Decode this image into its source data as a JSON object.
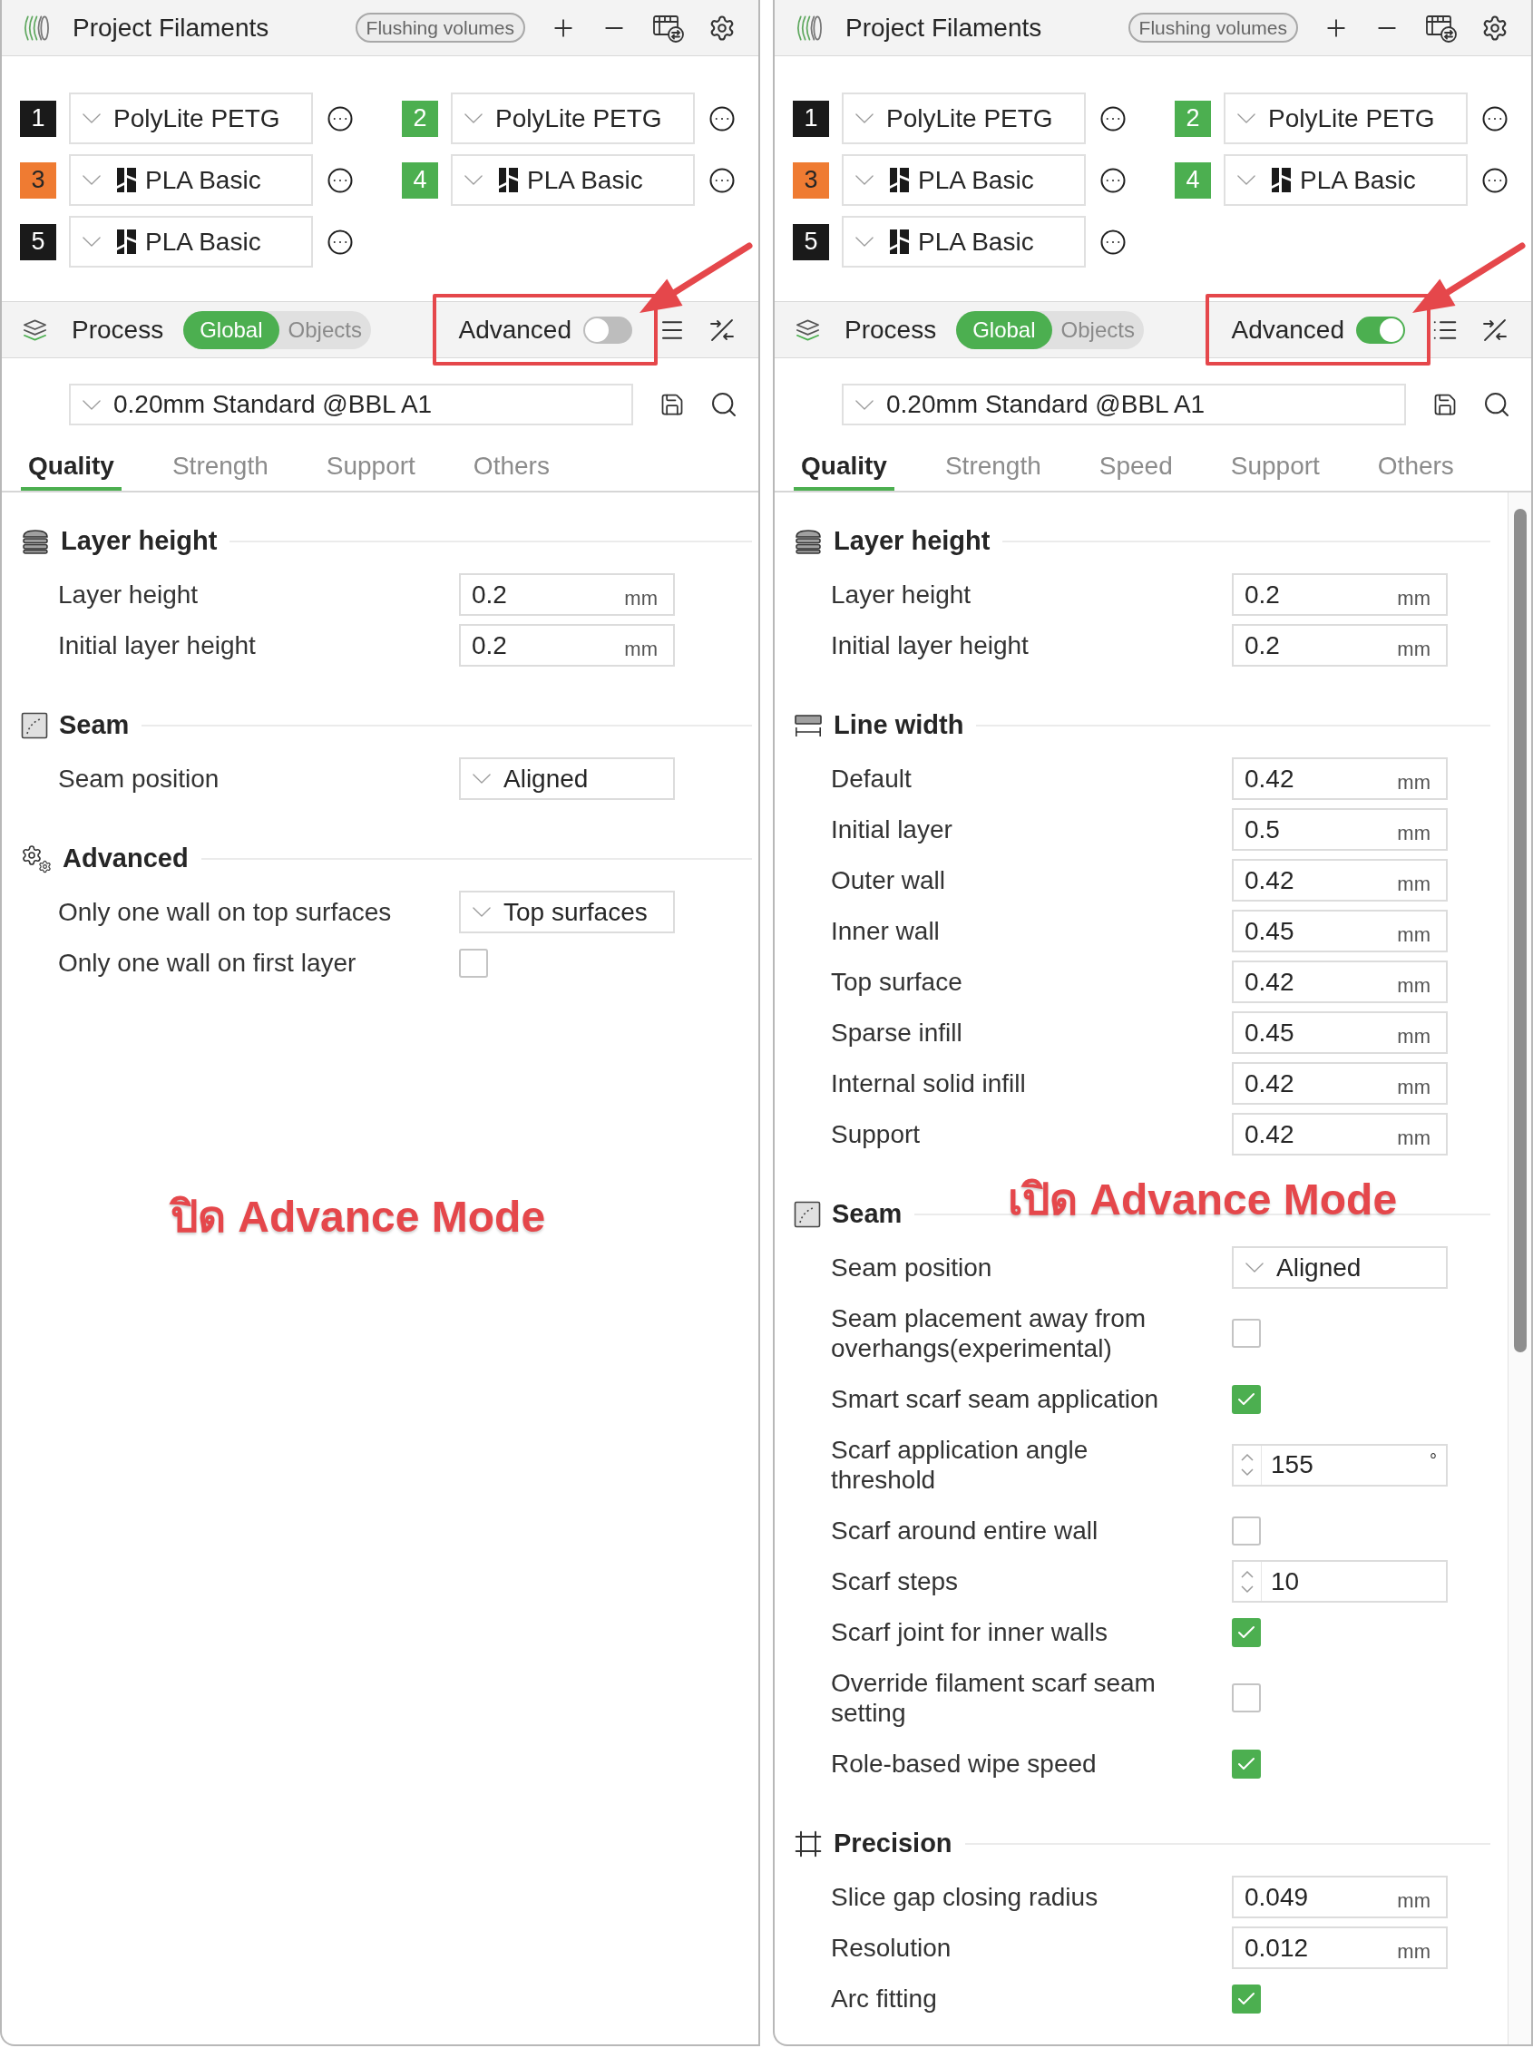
{
  "panels": [
    {
      "header": {
        "title": "Project Filaments",
        "flushing_button": "Flushing volumes"
      },
      "filaments": [
        {
          "number": "1",
          "color": "#1a1a1a",
          "name": "PolyLite PETG",
          "logo": false
        },
        {
          "number": "2",
          "color": "#4caf50",
          "name": "PolyLite PETG",
          "logo": false
        },
        {
          "number": "3",
          "color": "#ef7b32",
          "name": "PLA Basic",
          "logo": true
        },
        {
          "number": "4",
          "color": "#4caf50",
          "name": "PLA Basic",
          "logo": true
        },
        {
          "number": "5",
          "color": "#1a1a1a",
          "name": "PLA Basic",
          "logo": true
        }
      ],
      "process": {
        "title": "Process",
        "scopes": [
          {
            "label": "Global",
            "selected": true
          },
          {
            "label": "Objects",
            "selected": false
          }
        ],
        "advanced": {
          "label": "Advanced",
          "on": false
        }
      },
      "preset": "0.20mm Standard @BBL A1",
      "tabs": [
        {
          "label": "Quality",
          "selected": true
        },
        {
          "label": "Strength",
          "selected": false
        },
        {
          "label": "Support",
          "selected": false
        },
        {
          "label": "Others",
          "selected": false
        }
      ],
      "sections": [
        {
          "title": "Layer height",
          "kind": "layers",
          "rows": [
            {
              "kind": "number",
              "label": "Layer height",
              "value": "0.2",
              "unit": "mm"
            },
            {
              "kind": "number",
              "label": "Initial layer height",
              "value": "0.2",
              "unit": "mm"
            }
          ]
        },
        {
          "title": "Seam",
          "kind": "seam",
          "rows": [
            {
              "kind": "select",
              "label": "Seam position",
              "value": "Aligned"
            }
          ]
        },
        {
          "title": "Advanced",
          "kind": "advanced",
          "rows": [
            {
              "kind": "select",
              "label": "Only one wall on top surfaces",
              "value": "Top surfaces"
            },
            {
              "kind": "checkbox",
              "label": "Only one wall on first layer",
              "checked": false
            }
          ]
        }
      ],
      "annotation": "ปิด Advance Mode",
      "scrollbar": false
    },
    {
      "header": {
        "title": "Project Filaments",
        "flushing_button": "Flushing volumes"
      },
      "filaments": [
        {
          "number": "1",
          "color": "#1a1a1a",
          "name": "PolyLite PETG",
          "logo": false
        },
        {
          "number": "2",
          "color": "#4caf50",
          "name": "PolyLite PETG",
          "logo": false
        },
        {
          "number": "3",
          "color": "#ef7b32",
          "name": "PLA Basic",
          "logo": true
        },
        {
          "number": "4",
          "color": "#4caf50",
          "name": "PLA Basic",
          "logo": true
        },
        {
          "number": "5",
          "color": "#1a1a1a",
          "name": "PLA Basic",
          "logo": true
        }
      ],
      "process": {
        "title": "Process",
        "scopes": [
          {
            "label": "Global",
            "selected": true
          },
          {
            "label": "Objects",
            "selected": false
          }
        ],
        "advanced": {
          "label": "Advanced",
          "on": true
        }
      },
      "preset": "0.20mm Standard @BBL A1",
      "tabs": [
        {
          "label": "Quality",
          "selected": true
        },
        {
          "label": "Strength",
          "selected": false
        },
        {
          "label": "Speed",
          "selected": false
        },
        {
          "label": "Support",
          "selected": false
        },
        {
          "label": "Others",
          "selected": false
        }
      ],
      "sections": [
        {
          "title": "Layer height",
          "kind": "layers",
          "rows": [
            {
              "kind": "number",
              "label": "Layer height",
              "value": "0.2",
              "unit": "mm"
            },
            {
              "kind": "number",
              "label": "Initial layer height",
              "value": "0.2",
              "unit": "mm"
            }
          ]
        },
        {
          "title": "Line width",
          "kind": "linewidth",
          "rows": [
            {
              "kind": "number",
              "label": "Default",
              "value": "0.42",
              "unit": "mm"
            },
            {
              "kind": "number",
              "label": "Initial layer",
              "value": "0.5",
              "unit": "mm"
            },
            {
              "kind": "number",
              "label": "Outer wall",
              "value": "0.42",
              "unit": "mm"
            },
            {
              "kind": "number",
              "label": "Inner wall",
              "value": "0.45",
              "unit": "mm"
            },
            {
              "kind": "number",
              "label": "Top surface",
              "value": "0.42",
              "unit": "mm"
            },
            {
              "kind": "number",
              "label": "Sparse infill",
              "value": "0.45",
              "unit": "mm"
            },
            {
              "kind": "number",
              "label": "Internal solid infill",
              "value": "0.42",
              "unit": "mm"
            },
            {
              "kind": "number",
              "label": "Support",
              "value": "0.42",
              "unit": "mm"
            }
          ]
        },
        {
          "title": "Seam",
          "kind": "seam",
          "rows": [
            {
              "kind": "select",
              "label": "Seam position",
              "value": "Aligned"
            },
            {
              "kind": "checkbox",
              "label": "Seam placement away from overhangs(experimental)",
              "checked": false
            },
            {
              "kind": "checkbox",
              "label": "Smart scarf seam application",
              "checked": true
            },
            {
              "kind": "spin",
              "label": "Scarf application angle threshold",
              "value": "155",
              "unit": "°"
            },
            {
              "kind": "checkbox",
              "label": "Scarf around entire wall",
              "checked": false
            },
            {
              "kind": "spin",
              "label": "Scarf steps",
              "value": "10"
            },
            {
              "kind": "checkbox",
              "label": "Scarf joint for inner walls",
              "checked": true
            },
            {
              "kind": "checkbox",
              "label": "Override filament scarf seam setting",
              "checked": false
            },
            {
              "kind": "checkbox",
              "label": "Role-based wipe speed",
              "checked": true
            }
          ]
        },
        {
          "title": "Precision",
          "kind": "precision",
          "rows": [
            {
              "kind": "number",
              "label": "Slice gap closing radius",
              "value": "0.049",
              "unit": "mm"
            },
            {
              "kind": "number",
              "label": "Resolution",
              "value": "0.012",
              "unit": "mm"
            },
            {
              "kind": "checkbox",
              "label": "Arc fitting",
              "checked": true
            }
          ]
        }
      ],
      "annotation": "เปิด Advance Mode",
      "scrollbar": true
    }
  ]
}
